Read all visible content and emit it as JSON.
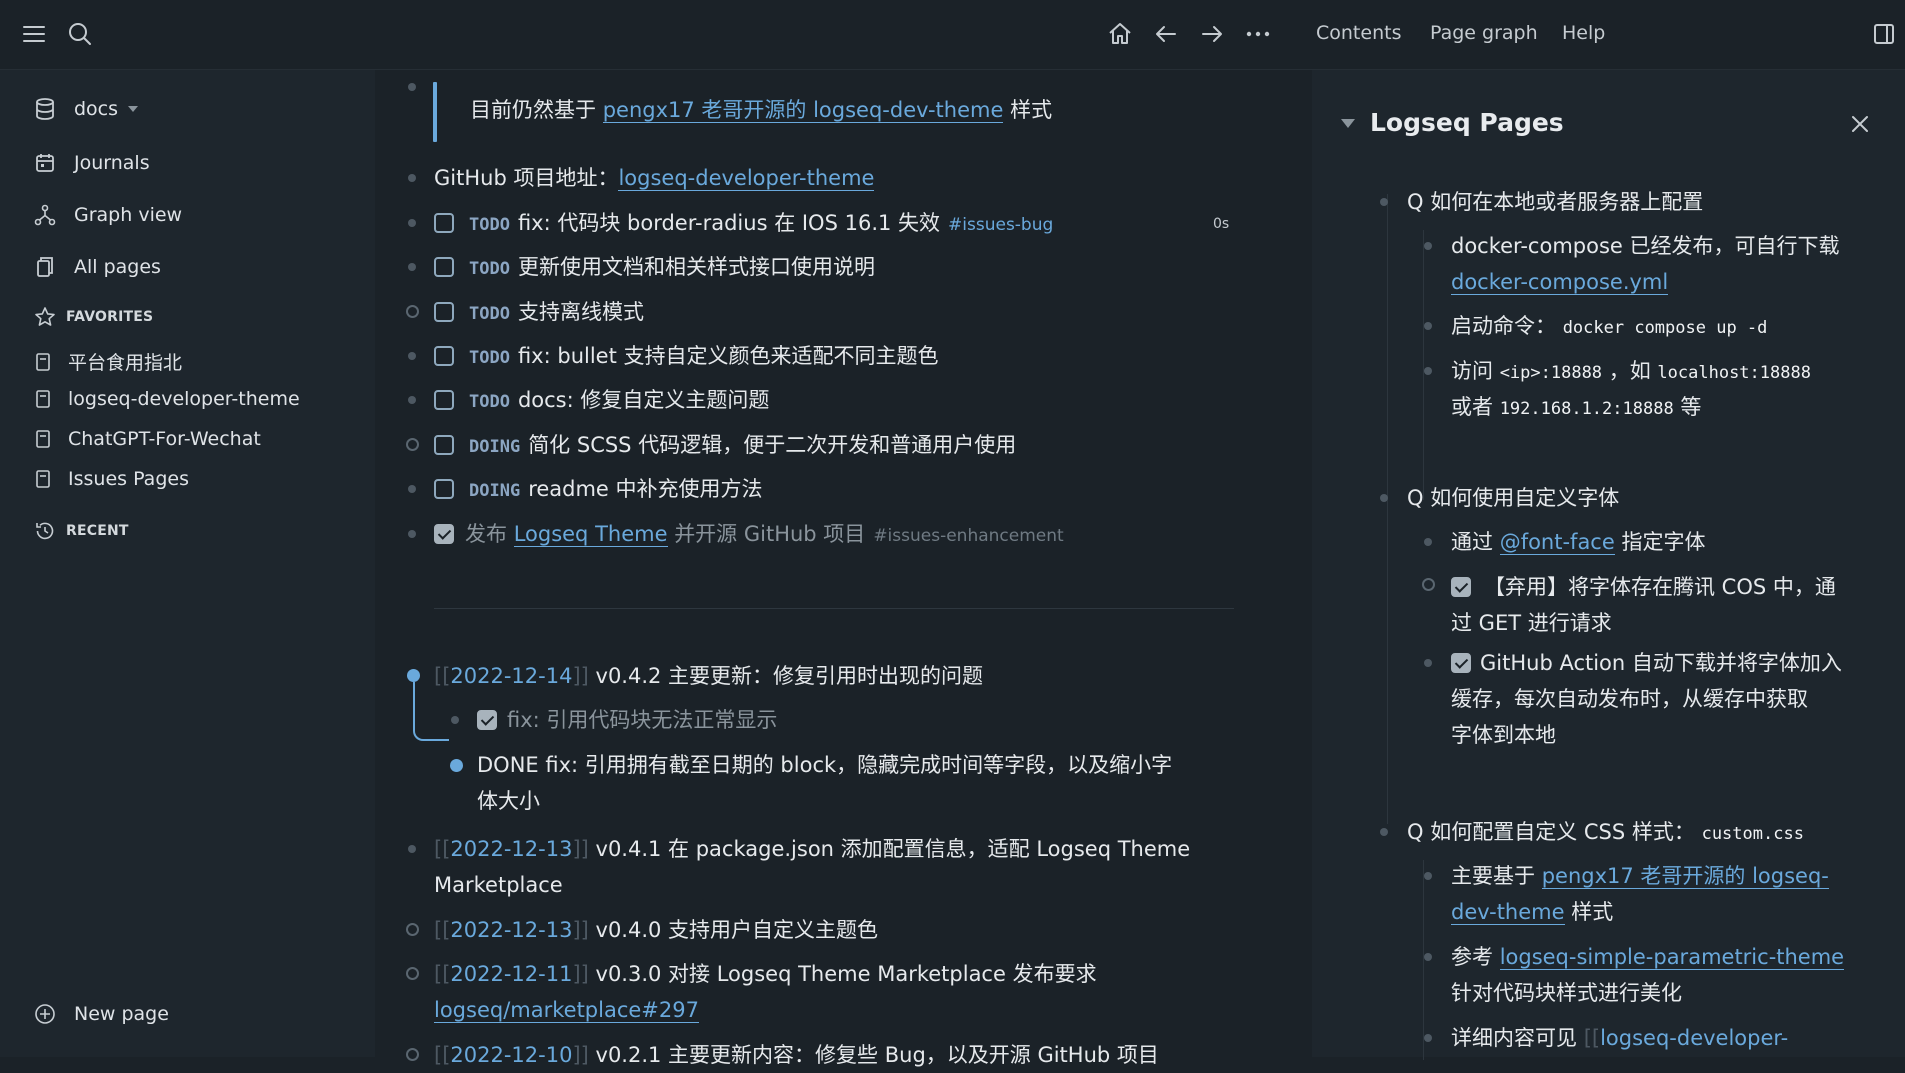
{
  "topbar": {
    "links": [
      "Contents",
      "Page graph",
      "Help"
    ],
    "icons": [
      "menu-icon",
      "search-icon",
      "home-icon",
      "arrow-left-icon",
      "arrow-right-icon",
      "more-icon",
      "right-sidebar-icon"
    ]
  },
  "sidebar": {
    "graph_name": "docs",
    "nav": [
      {
        "label": "Journals",
        "icon": "calendar-icon"
      },
      {
        "label": "Graph view",
        "icon": "graph-icon"
      },
      {
        "label": "All pages",
        "icon": "pages-icon"
      }
    ],
    "favorites_label": "FAVORITES",
    "favorites": [
      "平台食用指北",
      "logseq-developer-theme",
      "ChatGPT-For-Wechat",
      "Issues Pages"
    ],
    "recent_label": "RECENT",
    "new_page": "New page"
  },
  "main": {
    "quote_pre": "目前仍然基于",
    "quote_link": "pengx17 老哥开源的 logseq-dev-theme",
    "quote_post": "样式",
    "github_pre": "GitHub 项目地址：",
    "github_link": "logseq-developer-theme",
    "todos": [
      {
        "kw": "TODO",
        "text": "fix: 代码块 border-radius 在 IOS 16.1 失效",
        "tag": "#issues-bug",
        "time": "0s"
      },
      {
        "kw": "TODO",
        "text": "更新使用文档和相关样式接口使用说明"
      },
      {
        "kw": "TODO",
        "text": "支持离线模式"
      },
      {
        "kw": "TODO",
        "text": "fix: bullet 支持自定义颜色来适配不同主题色"
      },
      {
        "kw": "TODO",
        "text": "docs: 修复自定义主题问题"
      },
      {
        "kw": "DOING",
        "text": "简化 SCSS 代码逻辑，便于二次开发和普通用户使用"
      },
      {
        "kw": "DOING",
        "text": "readme 中补充使用方法"
      }
    ],
    "done_pre": "发布",
    "done_link": "Logseq Theme",
    "done_post": "并开源 GitHub 项目",
    "done_tag": "#issues-enhancement",
    "log": [
      {
        "date": "2022-12-14",
        "text": "v0.4.2 主要更新：修复引用时出现的问题"
      },
      {
        "date": "2022-12-13",
        "text": "v0.4.1 在 package.json 添加配置信息，适配 Logseq Theme",
        "text2": "Marketplace"
      },
      {
        "date": "2022-12-13",
        "text": "v0.4.0 支持用户自定义主题色"
      },
      {
        "date": "2022-12-11",
        "text": "v0.3.0 对接 Logseq Theme Marketplace 发布要求",
        "link2": "logseq/marketplace#297"
      },
      {
        "date": "2022-12-10",
        "text": "v0.2.1 主要更新内容：修复些 Bug，以及开源 GitHub 项目"
      }
    ],
    "sub1": "fix: 引用代码块无法正常显示",
    "sub2_line1": "DONE fix: 引用拥有截至日期的 block，隐藏完成时间等字段，以及缩小字",
    "sub2_line2": "体大小"
  },
  "right": {
    "title": "Logseq Pages",
    "q1": "Q 如何在本地或者服务器上配置",
    "q1_a": "docker-compose 已经发布，可自行下载",
    "q1_a_link": "docker-compose.yml",
    "q1_b_pre": "启动命令：",
    "q1_b_code": "docker compose up -d",
    "q1_c_pre": "访问",
    "q1_c_code1": "<ip>:18888",
    "q1_c_mid": "，如",
    "q1_c_code2": "localhost:18888",
    "q1_c_pre2": "或者",
    "q1_c_code3": "192.168.1.2:18888",
    "q1_c_post": "等",
    "q2": "Q 如何使用自定义字体",
    "q2_a_pre": "通过",
    "q2_a_link": "@font-face",
    "q2_a_post": "指定字体",
    "q2_b_1": "【弃用】将字体存在腾讯 COS 中，通",
    "q2_b_2": "过 GET 进行请求",
    "q2_c_1": "GitHub Action 自动下载并将字体加入",
    "q2_c_2": "缓存，每次自动发布时，从缓存中获取",
    "q2_c_3": "字体到本地",
    "q3_pre": "Q 如何配置自定义 CSS 样式：",
    "q3_code": "custom.css",
    "q3_a_pre": "主要基于",
    "q3_a_link1": "pengx17 老哥开源的 logseq-",
    "q3_a_link2": "dev-theme",
    "q3_a_post": "样式",
    "q3_b_pre": "参考",
    "q3_b_link": "logseq-simple-parametric-theme",
    "q3_b_2": "针对代码块样式进行美化",
    "q3_c_pre": "详细内容可见",
    "q3_c_link": "logseq-developer-"
  }
}
